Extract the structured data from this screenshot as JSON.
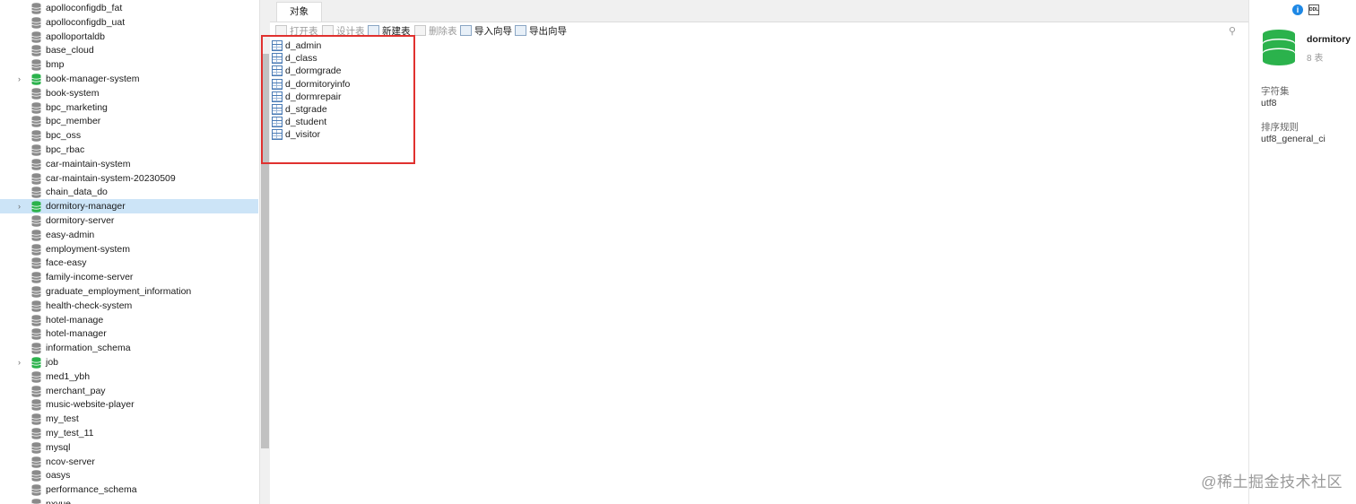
{
  "tree": {
    "selected_index": 14,
    "items": [
      {
        "label": "apolloconfigdb_fat",
        "open": false,
        "expandable": false
      },
      {
        "label": "apolloconfigdb_uat",
        "open": false,
        "expandable": false
      },
      {
        "label": "apolloportaldb",
        "open": false,
        "expandable": false
      },
      {
        "label": "base_cloud",
        "open": false,
        "expandable": false
      },
      {
        "label": "bmp",
        "open": false,
        "expandable": false
      },
      {
        "label": "book-manager-system",
        "open": true,
        "expandable": true
      },
      {
        "label": "book-system",
        "open": false,
        "expandable": false
      },
      {
        "label": "bpc_marketing",
        "open": false,
        "expandable": false
      },
      {
        "label": "bpc_member",
        "open": false,
        "expandable": false
      },
      {
        "label": "bpc_oss",
        "open": false,
        "expandable": false
      },
      {
        "label": "bpc_rbac",
        "open": false,
        "expandable": false
      },
      {
        "label": "car-maintain-system",
        "open": false,
        "expandable": false
      },
      {
        "label": "car-maintain-system-20230509",
        "open": false,
        "expandable": false
      },
      {
        "label": "chain_data_do",
        "open": false,
        "expandable": false
      },
      {
        "label": "dormitory-manager",
        "open": true,
        "expandable": true
      },
      {
        "label": "dormitory-server",
        "open": false,
        "expandable": false
      },
      {
        "label": "easy-admin",
        "open": false,
        "expandable": false
      },
      {
        "label": "employment-system",
        "open": false,
        "expandable": false
      },
      {
        "label": "face-easy",
        "open": false,
        "expandable": false
      },
      {
        "label": "family-income-server",
        "open": false,
        "expandable": false
      },
      {
        "label": "graduate_employment_information",
        "open": false,
        "expandable": false
      },
      {
        "label": "health-check-system",
        "open": false,
        "expandable": false
      },
      {
        "label": "hotel-manage",
        "open": false,
        "expandable": false
      },
      {
        "label": "hotel-manager",
        "open": false,
        "expandable": false
      },
      {
        "label": "information_schema",
        "open": false,
        "expandable": false
      },
      {
        "label": "job",
        "open": true,
        "expandable": true
      },
      {
        "label": "med1_ybh",
        "open": false,
        "expandable": false
      },
      {
        "label": "merchant_pay",
        "open": false,
        "expandable": false
      },
      {
        "label": "music-website-player",
        "open": false,
        "expandable": false
      },
      {
        "label": "my_test",
        "open": false,
        "expandable": false
      },
      {
        "label": "my_test_11",
        "open": false,
        "expandable": false
      },
      {
        "label": "mysql",
        "open": false,
        "expandable": false
      },
      {
        "label": "ncov-server",
        "open": false,
        "expandable": false
      },
      {
        "label": "oasys",
        "open": false,
        "expandable": false
      },
      {
        "label": "performance_schema",
        "open": false,
        "expandable": false
      },
      {
        "label": "nxvue",
        "open": false,
        "expandable": false
      }
    ]
  },
  "tabs": {
    "objects": "对象"
  },
  "toolbar": {
    "open_table": "打开表",
    "design_table": "设计表",
    "new_table": "新建表",
    "delete_table": "删除表",
    "import_wizard": "导入向导",
    "export_wizard": "导出向导"
  },
  "tables": [
    "d_admin",
    "d_class",
    "d_dormgrade",
    "d_dormitoryinfo",
    "d_dormrepair",
    "d_stgrade",
    "d_student",
    "d_visitor"
  ],
  "info": {
    "db_name": "dormitory",
    "table_count": "8 表",
    "charset_label": "字符集",
    "charset_value": "utf8",
    "collation_label": "排序规则",
    "collation_value": "utf8_general_ci",
    "ddl_icon_text": "DDL",
    "info_icon_text": "i"
  },
  "watermark": "@稀土掘金技术社区",
  "colors": {
    "open_db": "#2bb24c",
    "closed_db": "#8a8a8a",
    "selection": "#cce4f7",
    "highlight": "#e0312f"
  }
}
